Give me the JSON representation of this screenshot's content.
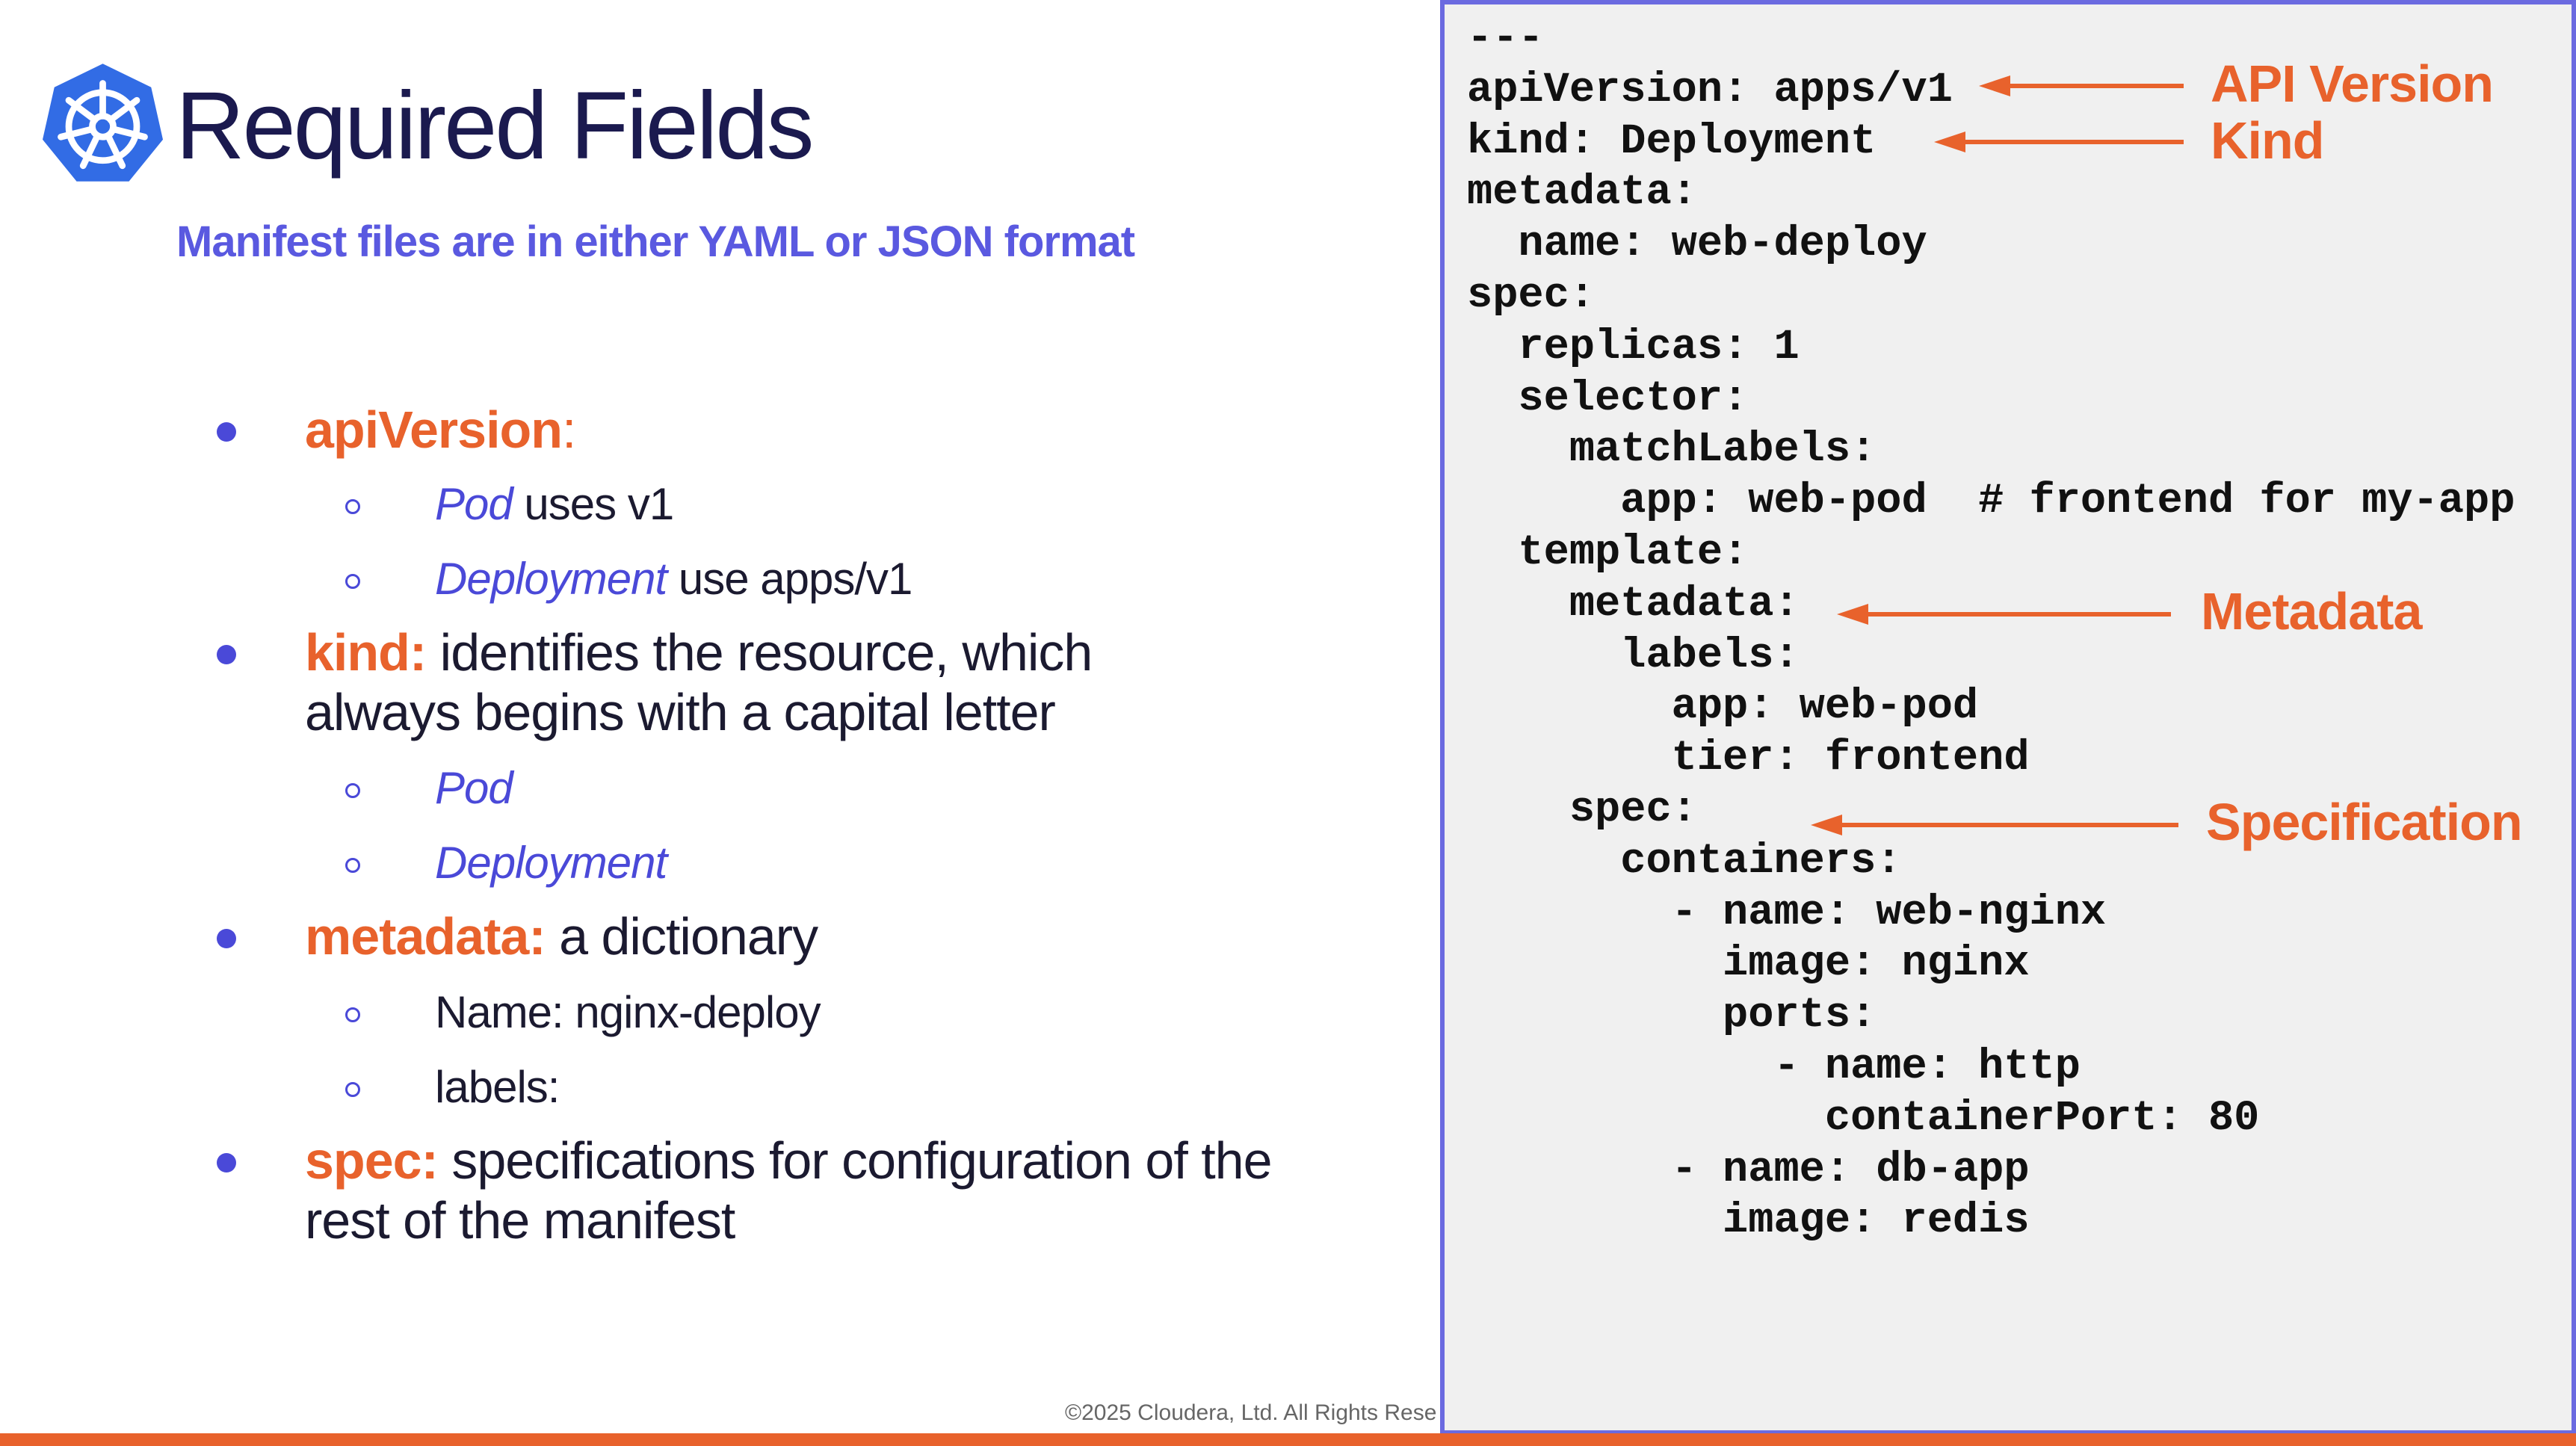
{
  "header": {
    "title": "Required Fields",
    "subtitle": "Manifest files are in either YAML or JSON format",
    "logo_icon": "kubernetes-helm-icon"
  },
  "bullets": [
    {
      "term": "apiVersion",
      "suffix": ":",
      "text": "",
      "subitems": [
        {
          "italic": "Pod",
          "text": " uses  v1"
        },
        {
          "italic": "Deployment",
          "text": " use apps/v1"
        }
      ]
    },
    {
      "term": "kind:",
      "text": " identifies the resource, which always begins with a capital letter",
      "subitems": [
        {
          "italic": "Pod",
          "text": ""
        },
        {
          "italic": "Deployment",
          "text": ""
        }
      ]
    },
    {
      "term": "metadata:",
      "text": " a dictionary",
      "subitems": [
        {
          "italic": "",
          "text": "Name: nginx-deploy"
        },
        {
          "italic": "",
          "text": "labels:"
        }
      ]
    },
    {
      "term": "spec:",
      "text": " specifications for configuration of the rest of the manifest",
      "subitems": []
    }
  ],
  "code": "---\napiVersion: apps/v1\nkind: Deployment\nmetadata:\n  name: web-deploy\nspec:\n  replicas: 1\n  selector:\n    matchLabels:\n      app: web-pod  # frontend for my-app\n  template:\n    metadata:\n      labels:\n        app: web-pod\n        tier: frontend\n    spec:\n      containers:\n        - name: web-nginx\n          image: nginx\n          ports:\n            - name: http\n              containerPort: 80\n        - name: db-app\n          image: redis",
  "annotations": {
    "api_version": "API Version",
    "kind": "Kind",
    "metadata": "Metadata",
    "specification": "Specification"
  },
  "footer": {
    "copyright": "©2025 Cloudera, Ltd. All Rights Rese"
  },
  "colors": {
    "accent_orange": "#e8622c",
    "accent_purple": "#4a49d8",
    "title_navy": "#1b1a4f",
    "kubernetes_blue": "#326ce5"
  }
}
